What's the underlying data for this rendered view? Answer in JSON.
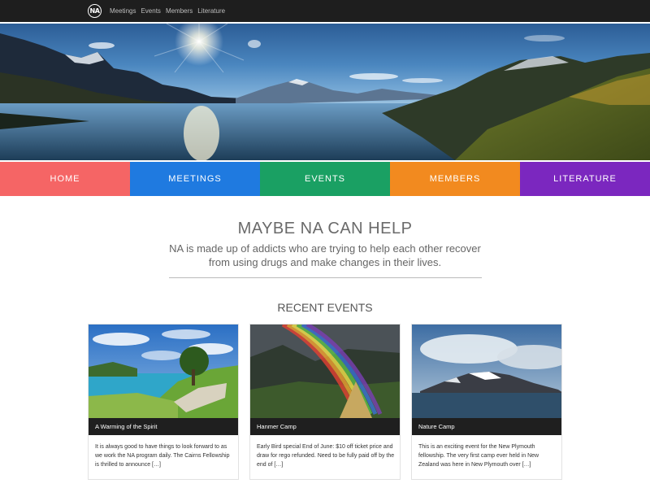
{
  "topnav": {
    "logo_text": "NA",
    "links": [
      "Meetings",
      "Events",
      "Members",
      "Literature"
    ]
  },
  "hero": {
    "image": "mountain-lake-landscape"
  },
  "colornav": {
    "items": [
      {
        "label": "HOME",
        "color": "#f56565"
      },
      {
        "label": "MEETINGS",
        "color": "#1f7ae0"
      },
      {
        "label": "EVENTS",
        "color": "#1aa063"
      },
      {
        "label": "MEMBERS",
        "color": "#f28a1f"
      },
      {
        "label": "LITERATURE",
        "color": "#7b27bf"
      }
    ]
  },
  "main": {
    "title": "MAYBE NA CAN HELP",
    "text": "NA is made up of addicts who are trying to help each other recover from using drugs and make changes in their lives."
  },
  "events": {
    "title": "RECENT EVENTS",
    "cards": [
      {
        "title": "A Warming of the Spirit",
        "text": "It is always good to have things to look forward to as we work the NA program daily. The Cairns Fellowship is thrilled to announce […]"
      },
      {
        "title": "Hanmer Camp",
        "text": "Early Bird special End of June: $10 off ticket price and draw for rego refunded. Need to be fully paid off by the end of […]"
      },
      {
        "title": "Nature Camp",
        "text": "This is an exciting event for the New Plymouth fellowship. The very first camp ever held in New Zealand was here in New Plymouth over […]"
      }
    ]
  }
}
